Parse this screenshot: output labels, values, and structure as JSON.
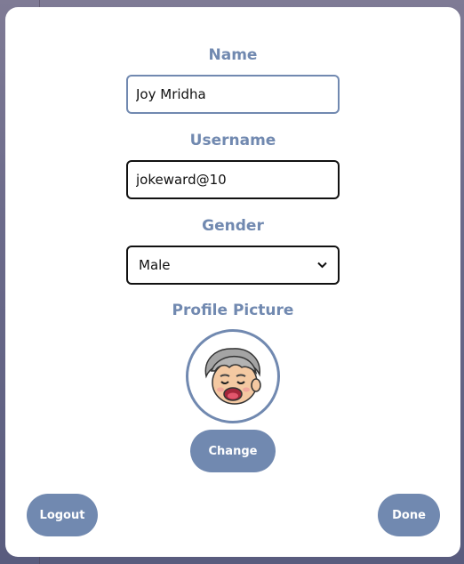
{
  "form": {
    "name_label": "Name",
    "name_value": "Joy Mridha",
    "username_label": "Username",
    "username_value": "jokeward@10",
    "gender_label": "Gender",
    "gender_value": "Male",
    "profile_picture_label": "Profile Picture"
  },
  "buttons": {
    "change": "Change",
    "logout": "Logout",
    "done": "Done"
  },
  "icons": {
    "avatar": "cartoon-avatar-icon",
    "dropdown": "chevron-down-icon"
  },
  "colors": {
    "accent": "#7189b0",
    "background": "#6b6a8a",
    "modal": "#ffffff"
  }
}
